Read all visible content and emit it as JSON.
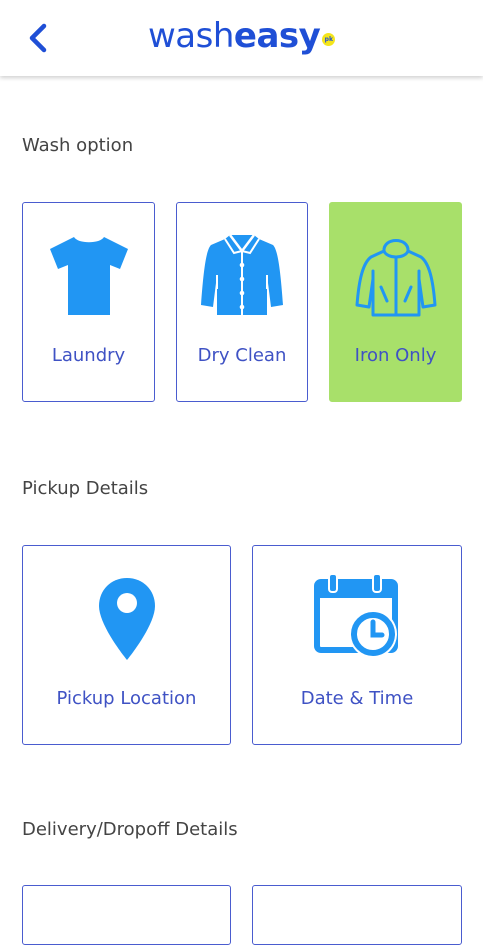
{
  "header": {
    "logo_part1": "wash",
    "logo_part2": "easy",
    "logo_badge": "pk"
  },
  "sections": {
    "wash": {
      "title": "Wash option",
      "options": [
        {
          "label": "Laundry",
          "icon": "tshirt-icon",
          "selected": false
        },
        {
          "label": "Dry Clean",
          "icon": "shirt-icon",
          "selected": false
        },
        {
          "label": "Iron Only",
          "icon": "jacket-icon",
          "selected": true
        }
      ]
    },
    "pickup": {
      "title": "Pickup Details",
      "options": [
        {
          "label": "Pickup Location",
          "icon": "location-pin-icon"
        },
        {
          "label": "Date & Time",
          "icon": "calendar-clock-icon"
        }
      ]
    },
    "delivery": {
      "title": "Delivery/Dropoff Details"
    }
  },
  "colors": {
    "accent": "#1f4fd6",
    "icon": "#2196f3",
    "card_border": "#4a5ccf",
    "selected_bg": "#a8e06a"
  }
}
